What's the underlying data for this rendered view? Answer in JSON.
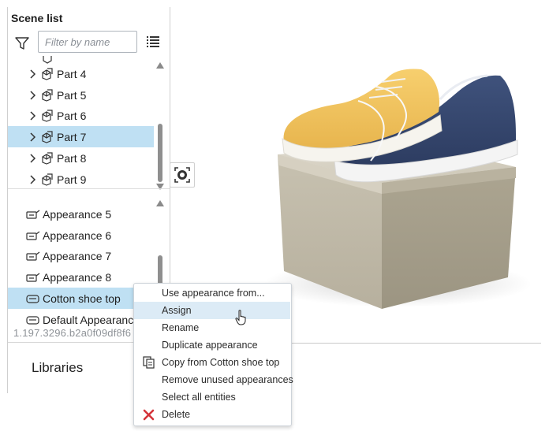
{
  "scene_list": {
    "title": "Scene list",
    "filter_placeholder": "Filter by name",
    "parts": [
      {
        "label": "Part 4",
        "selected": false
      },
      {
        "label": "Part 5",
        "selected": false
      },
      {
        "label": "Part 6",
        "selected": false
      },
      {
        "label": "Part 7",
        "selected": true
      },
      {
        "label": "Part 8",
        "selected": false
      },
      {
        "label": "Part 9",
        "selected": false
      }
    ],
    "appearances": [
      {
        "label": "Appearance 5",
        "selected": false
      },
      {
        "label": "Appearance 6",
        "selected": false
      },
      {
        "label": "Appearance 7",
        "selected": false
      },
      {
        "label": "Appearance 8",
        "selected": false
      },
      {
        "label": "Cotton shoe top",
        "selected": true
      },
      {
        "label": "Default Appearance",
        "selected": false
      }
    ],
    "version": "1.197.3296.b2a0f09df8f6"
  },
  "libraries": {
    "title": "Libraries"
  },
  "context_menu": {
    "items": [
      {
        "label": "Use appearance from...",
        "icon": "",
        "hover": false
      },
      {
        "label": "Assign",
        "icon": "",
        "hover": true
      },
      {
        "label": "Rename",
        "icon": "",
        "hover": false
      },
      {
        "label": "Duplicate appearance",
        "icon": "",
        "hover": false
      },
      {
        "label": "Copy from Cotton shoe top",
        "icon": "copy-icon",
        "hover": false
      },
      {
        "label": "Remove unused appearances",
        "icon": "",
        "hover": false
      },
      {
        "label": "Select all entities",
        "icon": "",
        "hover": false
      },
      {
        "label": "Delete",
        "icon": "delete-x-icon",
        "hover": false
      }
    ]
  },
  "colors": {
    "selection": "#bfe0f3",
    "menu_hover": "#dcebf6",
    "shoe_yellow": "#f3c45c",
    "shoe_navy": "#34466f",
    "box": "#c9c3b3",
    "delete_red": "#d4343a"
  }
}
